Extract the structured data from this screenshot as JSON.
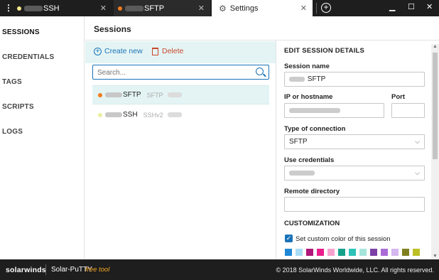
{
  "tabs": [
    {
      "label": "SSH",
      "dot_color": "#f3e78a"
    },
    {
      "label": "SFTP",
      "dot_color": "#f07b1c"
    },
    {
      "label": "Settings"
    }
  ],
  "sidebar": {
    "items": [
      {
        "label": "SESSIONS",
        "active": true
      },
      {
        "label": "CREDENTIALS"
      },
      {
        "label": "TAGS"
      },
      {
        "label": "SCRIPTS"
      },
      {
        "label": "LOGS"
      }
    ]
  },
  "sessions": {
    "title": "Sessions",
    "create_label": "Create new",
    "delete_label": "Delete",
    "search_placeholder": "Search...",
    "rows": [
      {
        "name": "SFTP",
        "type": "SFTP",
        "dot_color": "#f07b1c"
      },
      {
        "name": "SSH",
        "type": "SSHv2",
        "dot_color": "#e9f0a0"
      }
    ]
  },
  "edit": {
    "title": "EDIT SESSION DETAILS",
    "session_name_label": "Session name",
    "session_name_value": "SFTP",
    "host_label": "IP or hostname",
    "port_label": "Port",
    "connection_label": "Type of connection",
    "connection_value": "SFTP",
    "credentials_label": "Use credentials",
    "remote_dir_label": "Remote directory",
    "customization_label": "CUSTOMIZATION",
    "custom_color_label": "Set custom color of this session",
    "swatches": [
      "#1e88d6",
      "#a9dcf5",
      "#b0177a",
      "#e91e8c",
      "#f7a1cf",
      "#16a08a",
      "#2dc2b8",
      "#a5e5dc",
      "#7b3fa6",
      "#a96bd6",
      "#d4b8ef",
      "#7f7f22",
      "#bcc025"
    ]
  },
  "footer": {
    "brand": "solarwinds",
    "product": "Solar-PuTTY",
    "free": "free tool",
    "copyright": "© 2018 SolarWinds Worldwide, LLC. All rights reserved."
  }
}
